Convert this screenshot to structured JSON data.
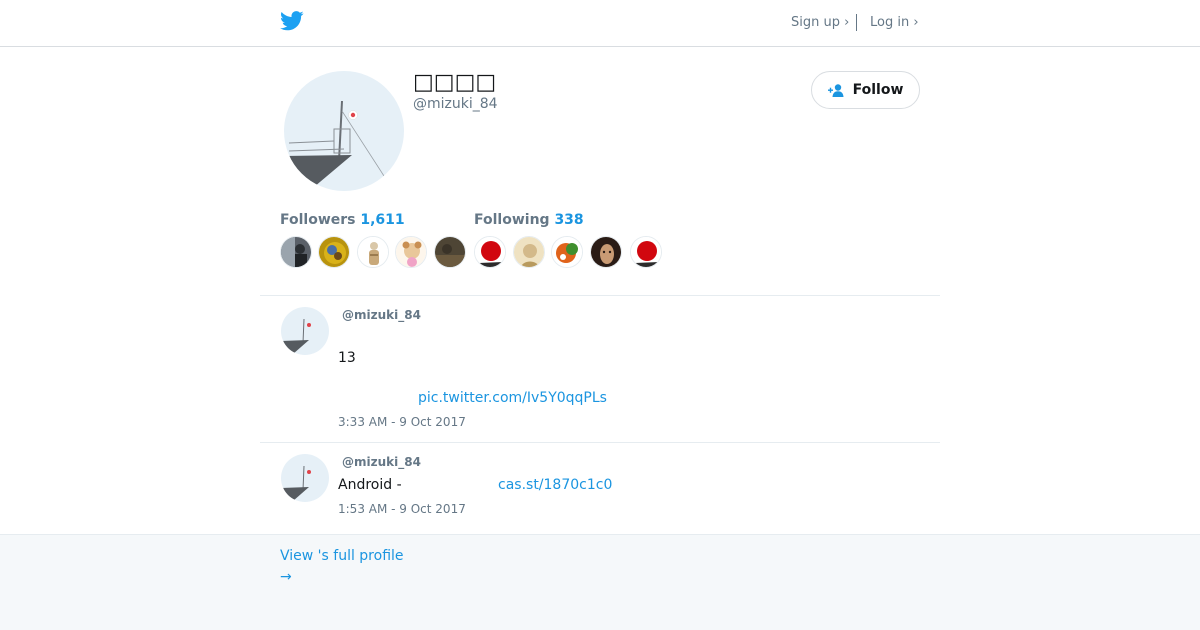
{
  "header": {
    "signup_label": "Sign up ›",
    "login_label": "Log in ›"
  },
  "profile": {
    "display_name": "□□□□",
    "handle": "@mizuki_84",
    "follow_label": "Follow"
  },
  "stats": {
    "followers_label": "Followers",
    "followers_count": "1,611",
    "following_label": "Following",
    "following_count": "338"
  },
  "tweets": [
    {
      "handle": "@mizuki_84",
      "text": "13",
      "link": "pic.twitter.com/Iv5Y0qqPLs",
      "time": "3:33 AM - 9 Oct 2017"
    },
    {
      "handle": "@mizuki_84",
      "text": "Android -",
      "link": "cas.st/1870c1c0",
      "time": "1:53 AM - 9 Oct 2017"
    }
  ],
  "footer": {
    "view_profile_label": "View 's full profile",
    "arrow": "→"
  },
  "colors": {
    "brand": "#1da1f2",
    "link": "#1b95e0",
    "muted": "#657786"
  }
}
